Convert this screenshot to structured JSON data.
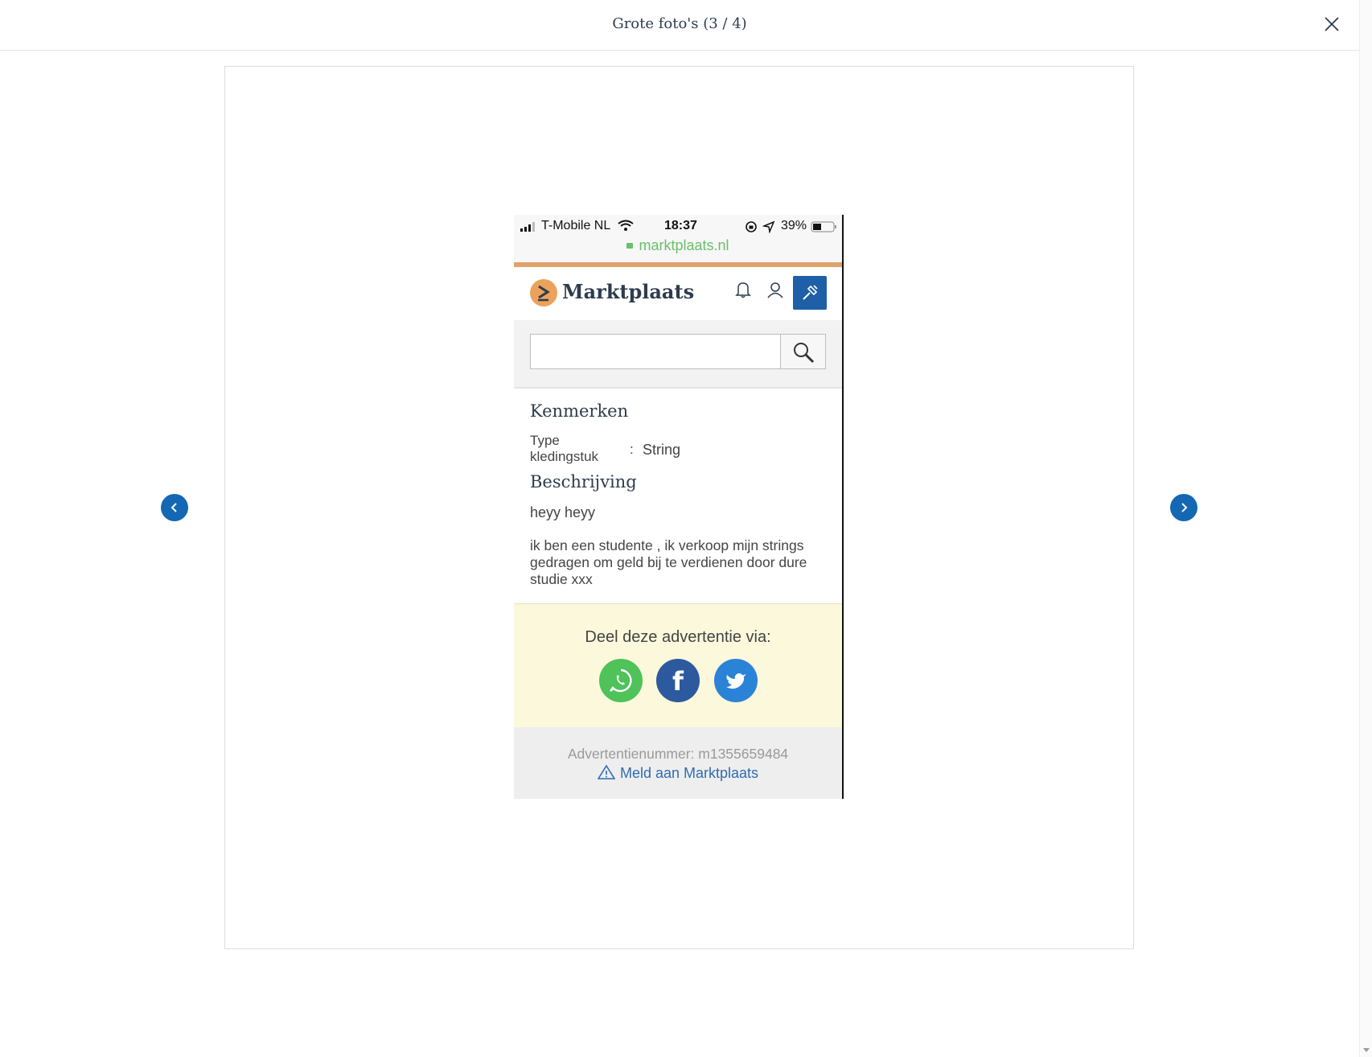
{
  "modal": {
    "title": "Grote foto's (3 / 4)",
    "close_icon": "close-icon"
  },
  "navigation": {
    "prev_icon": "chevron-left-icon",
    "next_icon": "chevron-right-icon",
    "accent_color": "#1468b3"
  },
  "photo": {
    "status_bar": {
      "carrier": "T-Mobile NL",
      "time": "18:37",
      "battery": "39%"
    },
    "url": "marktplaats.nl",
    "site": {
      "logo_text": "Marktplaats",
      "brand_color": "#eca25b",
      "button_color": "#1e5fa8"
    },
    "kenmerken": {
      "title": "Kenmerken",
      "attribute_label": "Type kledingstuk",
      "separator": ":",
      "attribute_value": "String"
    },
    "beschrijving": {
      "title": "Beschrijving",
      "line1": "heyy heyy",
      "paragraph": "ik ben een studente , ik verkoop mijn strings gedragen om geld bij te verdienen door dure studie xxx"
    },
    "share": {
      "title": "Deel deze advertentie via:",
      "buttons": [
        "whatsapp-icon",
        "facebook-icon",
        "twitter-icon"
      ]
    },
    "footer": {
      "ad_number": "Advertentienummer: m1355659484",
      "report_link": "Meld aan Marktplaats"
    }
  }
}
